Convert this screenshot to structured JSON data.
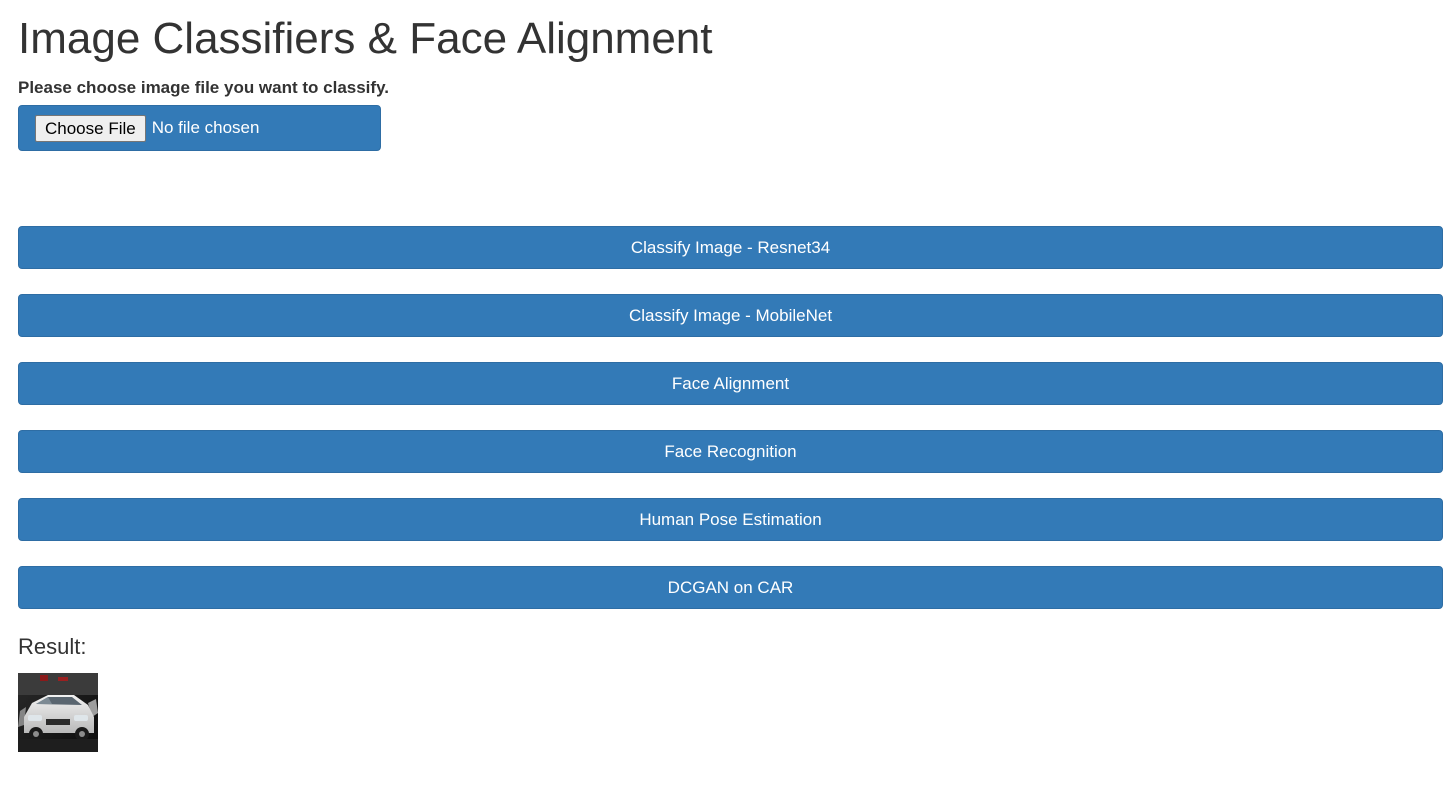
{
  "header": {
    "title": "Image Classifiers & Face Alignment"
  },
  "upload": {
    "prompt": "Please choose image file you want to classify.",
    "choose_label": "Choose File",
    "status": "No file chosen"
  },
  "actions": [
    {
      "label": "Classify Image - Resnet34"
    },
    {
      "label": "Classify Image - MobileNet"
    },
    {
      "label": "Face Alignment"
    },
    {
      "label": "Face Recognition"
    },
    {
      "label": "Human Pose Estimation"
    },
    {
      "label": "DCGAN on CAR"
    }
  ],
  "result": {
    "label": "Result:",
    "image_icon": "car-image"
  },
  "colors": {
    "primary": "#337ab7",
    "primary_border": "#2e6da4",
    "text": "#333333"
  }
}
